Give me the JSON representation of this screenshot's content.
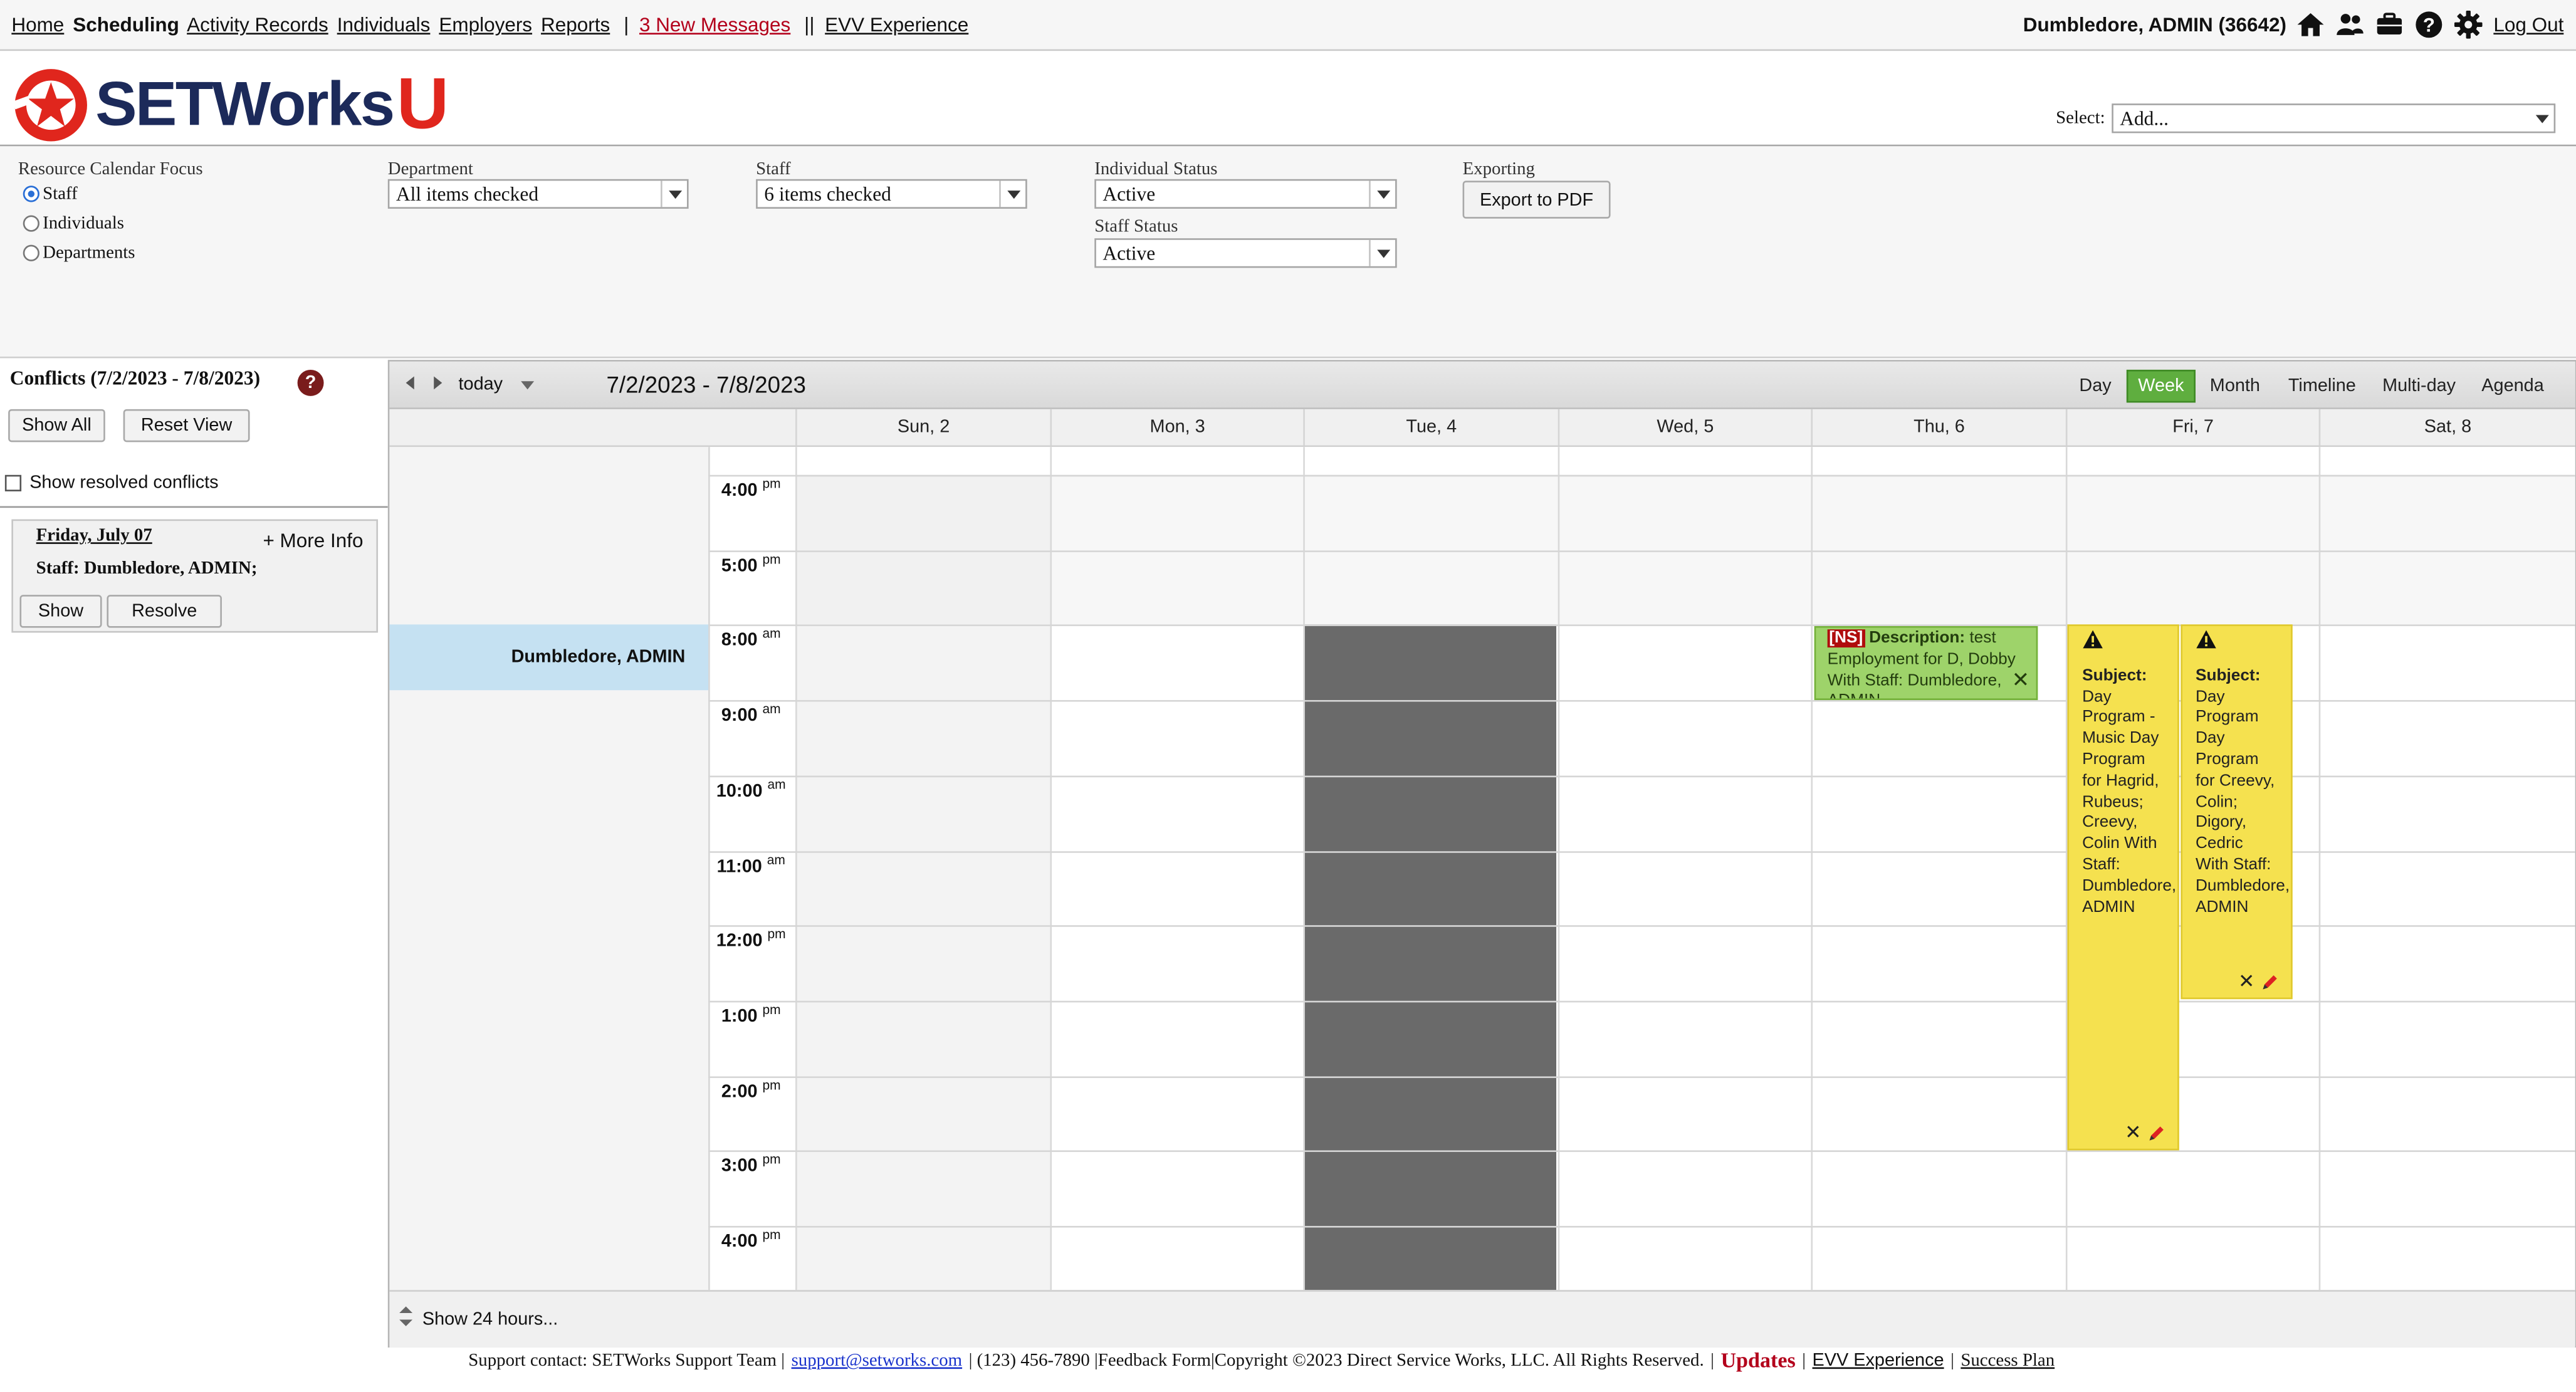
{
  "nav": {
    "links": [
      "Home",
      "Scheduling",
      "Activity Records",
      "Individuals",
      "Employers",
      "Reports"
    ],
    "messages": "3 New Messages",
    "evv": "EVV Experience",
    "user": "Dumbledore, ADMIN  (36642)",
    "logout": "Log Out"
  },
  "brand": {
    "word": "SETWorks",
    "u": "U"
  },
  "select": {
    "label": "Select:",
    "value": "Add..."
  },
  "filters": {
    "focus_label": "Resource Calendar Focus",
    "focus_options": [
      "Staff",
      "Individuals",
      "Departments"
    ],
    "focus_selected": "Staff",
    "department_label": "Department",
    "department_value": "All items checked",
    "staff_label": "Staff",
    "staff_value": "6 items checked",
    "individual_status_label": "Individual Status",
    "individual_status_value": "Active",
    "staff_status_label": "Staff Status",
    "staff_status_value": "Active",
    "exporting_label": "Exporting",
    "export_button": "Export to PDF"
  },
  "conflicts": {
    "title": "Conflicts (7/2/2023 - 7/8/2023)",
    "help": "?",
    "show_all": "Show All",
    "reset_view": "Reset View",
    "show_resolved": "Show resolved conflicts",
    "card": {
      "date": "Friday, July 07",
      "more_info": "+ More Info",
      "staff": "Staff: Dumbledore, ADMIN;",
      "show": "Show",
      "resolve": "Resolve"
    }
  },
  "calendar": {
    "today": "today",
    "range": "7/2/2023 - 7/8/2023",
    "views": [
      "Day",
      "Week",
      "Month",
      "Timeline",
      "Multi-day",
      "Agenda"
    ],
    "active_view": "Week",
    "days": [
      "Sun, 2",
      "Mon, 3",
      "Tue, 4",
      "Wed, 5",
      "Thu, 6",
      "Fri, 7",
      "Sat, 8"
    ],
    "resource": "Dumbledore, ADMIN",
    "times": [
      {
        "t": "4:00",
        "p": "pm"
      },
      {
        "t": "5:00",
        "p": "pm"
      },
      {
        "t": "8:00",
        "p": "am"
      },
      {
        "t": "9:00",
        "p": "am"
      },
      {
        "t": "10:00",
        "p": "am"
      },
      {
        "t": "11:00",
        "p": "am"
      },
      {
        "t": "12:00",
        "p": "pm"
      },
      {
        "t": "1:00",
        "p": "pm"
      },
      {
        "t": "2:00",
        "p": "pm"
      },
      {
        "t": "3:00",
        "p": "pm"
      },
      {
        "t": "4:00",
        "p": "pm"
      }
    ],
    "events": {
      "thu": {
        "tag": "[NS]",
        "label": "Description:",
        "text": "test Employment for D, Dobby With Staff: Dumbledore, ADMIN"
      },
      "fri1": {
        "label": "Subject:",
        "text": "Day Program - Music Day Program for Hagrid, Rubeus; Creevy, Colin With Staff: Dumbledore, ADMIN"
      },
      "fri2": {
        "label": "Subject:",
        "text": "Day Program Day Program for Creevy, Colin; Digory, Cedric With Staff: Dumbledore, ADMIN"
      }
    },
    "show_hours": "Show 24 hours..."
  },
  "footer": {
    "support": "Support contact: SETWorks Support Team |",
    "email": "support@setworks.com",
    "rest": "| (123) 456-7890 |Feedback Form|Copyright ©2023 Direct Service Works, LLC. All Rights Reserved.",
    "updates": "Updates",
    "evv": "EVV Experience",
    "success": "Success Plan"
  },
  "colors": {
    "accent_green": "#5fae3f",
    "event_green": "#9ed36a",
    "event_yellow": "#f5e14f",
    "blocked_gray": "#6a6a6a",
    "resource_blue": "#c5e1f2",
    "brand_red": "#e0261d",
    "brand_navy": "#1c2a5a"
  }
}
